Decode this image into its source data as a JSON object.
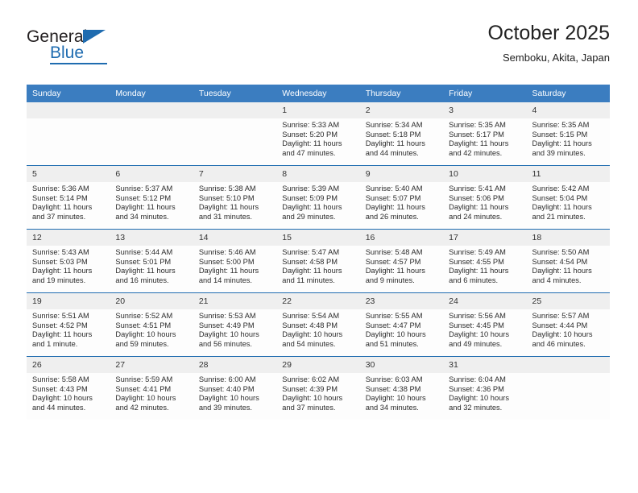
{
  "brand": {
    "name_top": "General",
    "name_bottom": "Blue",
    "accent_color": "#1f6cb0"
  },
  "header": {
    "title": "October 2025",
    "subtitle": "Semboku, Akita, Japan"
  },
  "calendar": {
    "header_bg": "#3b7dc0",
    "daynum_bg": "#efefef",
    "row_divider_color": "#1f6cb0",
    "weekday_headers": [
      "Sunday",
      "Monday",
      "Tuesday",
      "Wednesday",
      "Thursday",
      "Friday",
      "Saturday"
    ],
    "weeks": [
      [
        {
          "day": "",
          "lines": []
        },
        {
          "day": "",
          "lines": []
        },
        {
          "day": "",
          "lines": []
        },
        {
          "day": "1",
          "lines": [
            "Sunrise: 5:33 AM",
            "Sunset: 5:20 PM",
            "Daylight: 11 hours",
            "and 47 minutes."
          ]
        },
        {
          "day": "2",
          "lines": [
            "Sunrise: 5:34 AM",
            "Sunset: 5:18 PM",
            "Daylight: 11 hours",
            "and 44 minutes."
          ]
        },
        {
          "day": "3",
          "lines": [
            "Sunrise: 5:35 AM",
            "Sunset: 5:17 PM",
            "Daylight: 11 hours",
            "and 42 minutes."
          ]
        },
        {
          "day": "4",
          "lines": [
            "Sunrise: 5:35 AM",
            "Sunset: 5:15 PM",
            "Daylight: 11 hours",
            "and 39 minutes."
          ]
        }
      ],
      [
        {
          "day": "5",
          "lines": [
            "Sunrise: 5:36 AM",
            "Sunset: 5:14 PM",
            "Daylight: 11 hours",
            "and 37 minutes."
          ]
        },
        {
          "day": "6",
          "lines": [
            "Sunrise: 5:37 AM",
            "Sunset: 5:12 PM",
            "Daylight: 11 hours",
            "and 34 minutes."
          ]
        },
        {
          "day": "7",
          "lines": [
            "Sunrise: 5:38 AM",
            "Sunset: 5:10 PM",
            "Daylight: 11 hours",
            "and 31 minutes."
          ]
        },
        {
          "day": "8",
          "lines": [
            "Sunrise: 5:39 AM",
            "Sunset: 5:09 PM",
            "Daylight: 11 hours",
            "and 29 minutes."
          ]
        },
        {
          "day": "9",
          "lines": [
            "Sunrise: 5:40 AM",
            "Sunset: 5:07 PM",
            "Daylight: 11 hours",
            "and 26 minutes."
          ]
        },
        {
          "day": "10",
          "lines": [
            "Sunrise: 5:41 AM",
            "Sunset: 5:06 PM",
            "Daylight: 11 hours",
            "and 24 minutes."
          ]
        },
        {
          "day": "11",
          "lines": [
            "Sunrise: 5:42 AM",
            "Sunset: 5:04 PM",
            "Daylight: 11 hours",
            "and 21 minutes."
          ]
        }
      ],
      [
        {
          "day": "12",
          "lines": [
            "Sunrise: 5:43 AM",
            "Sunset: 5:03 PM",
            "Daylight: 11 hours",
            "and 19 minutes."
          ]
        },
        {
          "day": "13",
          "lines": [
            "Sunrise: 5:44 AM",
            "Sunset: 5:01 PM",
            "Daylight: 11 hours",
            "and 16 minutes."
          ]
        },
        {
          "day": "14",
          "lines": [
            "Sunrise: 5:46 AM",
            "Sunset: 5:00 PM",
            "Daylight: 11 hours",
            "and 14 minutes."
          ]
        },
        {
          "day": "15",
          "lines": [
            "Sunrise: 5:47 AM",
            "Sunset: 4:58 PM",
            "Daylight: 11 hours",
            "and 11 minutes."
          ]
        },
        {
          "day": "16",
          "lines": [
            "Sunrise: 5:48 AM",
            "Sunset: 4:57 PM",
            "Daylight: 11 hours",
            "and 9 minutes."
          ]
        },
        {
          "day": "17",
          "lines": [
            "Sunrise: 5:49 AM",
            "Sunset: 4:55 PM",
            "Daylight: 11 hours",
            "and 6 minutes."
          ]
        },
        {
          "day": "18",
          "lines": [
            "Sunrise: 5:50 AM",
            "Sunset: 4:54 PM",
            "Daylight: 11 hours",
            "and 4 minutes."
          ]
        }
      ],
      [
        {
          "day": "19",
          "lines": [
            "Sunrise: 5:51 AM",
            "Sunset: 4:52 PM",
            "Daylight: 11 hours",
            "and 1 minute."
          ]
        },
        {
          "day": "20",
          "lines": [
            "Sunrise: 5:52 AM",
            "Sunset: 4:51 PM",
            "Daylight: 10 hours",
            "and 59 minutes."
          ]
        },
        {
          "day": "21",
          "lines": [
            "Sunrise: 5:53 AM",
            "Sunset: 4:49 PM",
            "Daylight: 10 hours",
            "and 56 minutes."
          ]
        },
        {
          "day": "22",
          "lines": [
            "Sunrise: 5:54 AM",
            "Sunset: 4:48 PM",
            "Daylight: 10 hours",
            "and 54 minutes."
          ]
        },
        {
          "day": "23",
          "lines": [
            "Sunrise: 5:55 AM",
            "Sunset: 4:47 PM",
            "Daylight: 10 hours",
            "and 51 minutes."
          ]
        },
        {
          "day": "24",
          "lines": [
            "Sunrise: 5:56 AM",
            "Sunset: 4:45 PM",
            "Daylight: 10 hours",
            "and 49 minutes."
          ]
        },
        {
          "day": "25",
          "lines": [
            "Sunrise: 5:57 AM",
            "Sunset: 4:44 PM",
            "Daylight: 10 hours",
            "and 46 minutes."
          ]
        }
      ],
      [
        {
          "day": "26",
          "lines": [
            "Sunrise: 5:58 AM",
            "Sunset: 4:43 PM",
            "Daylight: 10 hours",
            "and 44 minutes."
          ]
        },
        {
          "day": "27",
          "lines": [
            "Sunrise: 5:59 AM",
            "Sunset: 4:41 PM",
            "Daylight: 10 hours",
            "and 42 minutes."
          ]
        },
        {
          "day": "28",
          "lines": [
            "Sunrise: 6:00 AM",
            "Sunset: 4:40 PM",
            "Daylight: 10 hours",
            "and 39 minutes."
          ]
        },
        {
          "day": "29",
          "lines": [
            "Sunrise: 6:02 AM",
            "Sunset: 4:39 PM",
            "Daylight: 10 hours",
            "and 37 minutes."
          ]
        },
        {
          "day": "30",
          "lines": [
            "Sunrise: 6:03 AM",
            "Sunset: 4:38 PM",
            "Daylight: 10 hours",
            "and 34 minutes."
          ]
        },
        {
          "day": "31",
          "lines": [
            "Sunrise: 6:04 AM",
            "Sunset: 4:36 PM",
            "Daylight: 10 hours",
            "and 32 minutes."
          ]
        },
        {
          "day": "",
          "lines": []
        }
      ]
    ]
  }
}
